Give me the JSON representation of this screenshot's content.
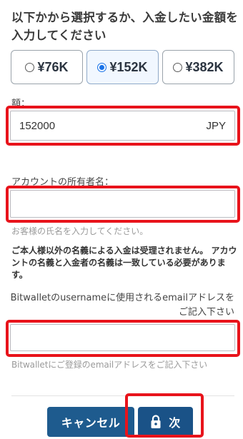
{
  "heading": "以下かから選択するか、入金したい金額を入力してください",
  "amount_options": [
    {
      "label": "¥76K",
      "selected": false
    },
    {
      "label": "¥152K",
      "selected": true
    },
    {
      "label": "¥382K",
      "selected": false
    }
  ],
  "amount": {
    "label": "額：",
    "value": "152000",
    "currency": "JPY"
  },
  "owner": {
    "label": "アカウントの所有者名：",
    "value": "",
    "hint": "お客様の氏名を入力してください。"
  },
  "warning": "ご本人様以外の名義による入金は受理されません。 アカウントの名義と入金者の名義は一致している必要があります。",
  "email": {
    "label": "Bitwalletのusernameに使用されるemailアドレスをご記入下さい",
    "value": "",
    "hint": "Bitwalletにご登録のemailアドレスをご記入下さい"
  },
  "buttons": {
    "cancel": "キャンセル",
    "next": "次"
  },
  "colors": {
    "highlight_frame": "#e8131b",
    "button_bg": "#1e5b8e",
    "radio_selected": "#1a73e8"
  }
}
